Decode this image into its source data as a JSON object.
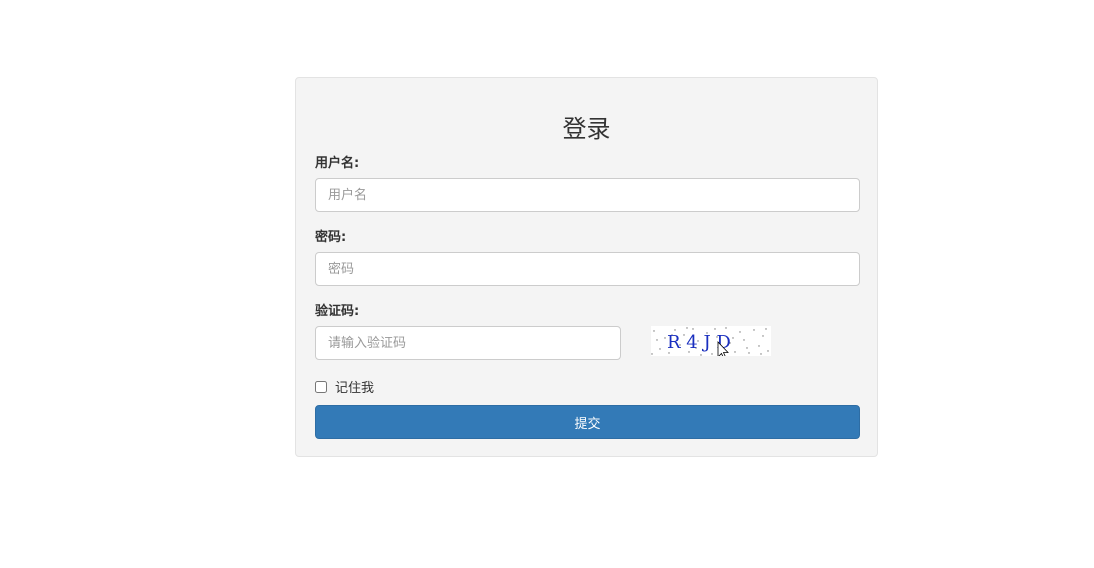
{
  "form": {
    "title": "登录",
    "username": {
      "label": "用户名:",
      "placeholder": "用户名",
      "value": ""
    },
    "password": {
      "label": "密码:",
      "placeholder": "密码",
      "value": ""
    },
    "captcha": {
      "label": "验证码:",
      "placeholder": "请输入验证码",
      "value": "",
      "image_text": "R 4 J D"
    },
    "remember": {
      "label": "记住我",
      "checked": false
    },
    "submit_label": "提交"
  },
  "colors": {
    "panel_bg": "#f4f4f4",
    "primary": "#337ab7",
    "captcha_text": "#1a2fbf"
  }
}
